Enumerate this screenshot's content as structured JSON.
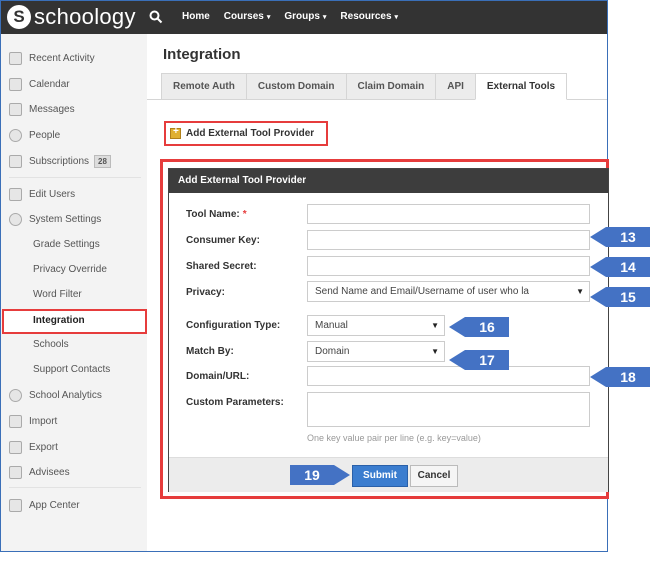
{
  "app": {
    "logo_letter": "S",
    "logo_text": "schoology",
    "search_icon": "search-icon"
  },
  "nav": {
    "items": [
      {
        "label": "Home",
        "has_caret": false
      },
      {
        "label": "Courses",
        "has_caret": true
      },
      {
        "label": "Groups",
        "has_caret": true
      },
      {
        "label": "Resources",
        "has_caret": true
      }
    ],
    "caret": "▾"
  },
  "sidebar": {
    "items": [
      {
        "label": "Recent Activity",
        "icon": "list-icon"
      },
      {
        "label": "Calendar",
        "icon": "calendar-icon"
      },
      {
        "label": "Messages",
        "icon": "envelope-icon"
      },
      {
        "label": "People",
        "icon": "person-icon"
      },
      {
        "label": "Subscriptions",
        "icon": "subscriptions-icon",
        "badge": "28"
      },
      {
        "label": "Edit Users",
        "icon": "edit-users-icon"
      },
      {
        "label": "System Settings",
        "icon": "gear-icon"
      },
      {
        "label": "Grade Settings",
        "sub": true
      },
      {
        "label": "Privacy Override",
        "sub": true
      },
      {
        "label": "Word Filter",
        "sub": true
      },
      {
        "label": "Integration",
        "sub": true,
        "active": true
      },
      {
        "label": "Schools",
        "sub": true
      },
      {
        "label": "Support Contacts",
        "sub": true
      },
      {
        "label": "School Analytics",
        "icon": "analytics-icon"
      },
      {
        "label": "Import",
        "icon": "import-icon"
      },
      {
        "label": "Export",
        "icon": "export-icon"
      },
      {
        "label": "Advisees",
        "icon": "advisees-icon"
      },
      {
        "label": "App Center",
        "icon": "app-center-icon"
      }
    ]
  },
  "main": {
    "title": "Integration",
    "tabs": [
      "Remote Auth",
      "Custom Domain",
      "Claim Domain",
      "API",
      "External Tools"
    ],
    "active_tab": "External Tools",
    "add_button_label": "Add External Tool Provider"
  },
  "dialog": {
    "title": "Add External Tool Provider",
    "fields": {
      "tool_name_label": "Tool Name:",
      "tool_name_required": "*",
      "tool_name_value": "",
      "consumer_key_label": "Consumer Key:",
      "consumer_key_value": "",
      "shared_secret_label": "Shared Secret:",
      "shared_secret_value": "",
      "privacy_label": "Privacy:",
      "privacy_value": "Send Name and Email/Username of user who la",
      "configuration_type_label": "Configuration Type:",
      "configuration_type_value": "Manual",
      "match_by_label": "Match By:",
      "match_by_value": "Domain",
      "domain_url_label": "Domain/URL:",
      "domain_url_value": "",
      "custom_parameters_label": "Custom Parameters:",
      "custom_parameters_hint": "One key value pair per line (e.g. key=value)"
    },
    "submit_label": "Submit",
    "cancel_label": "Cancel",
    "select_arrow": "▼"
  },
  "callouts": [
    "13",
    "14",
    "15",
    "16",
    "17",
    "18",
    "19"
  ],
  "colors": {
    "callout_fill": "#4472c4",
    "highlight_red": "#e63c3c",
    "topbar": "#333333",
    "submit_blue": "#3b7dcf"
  }
}
